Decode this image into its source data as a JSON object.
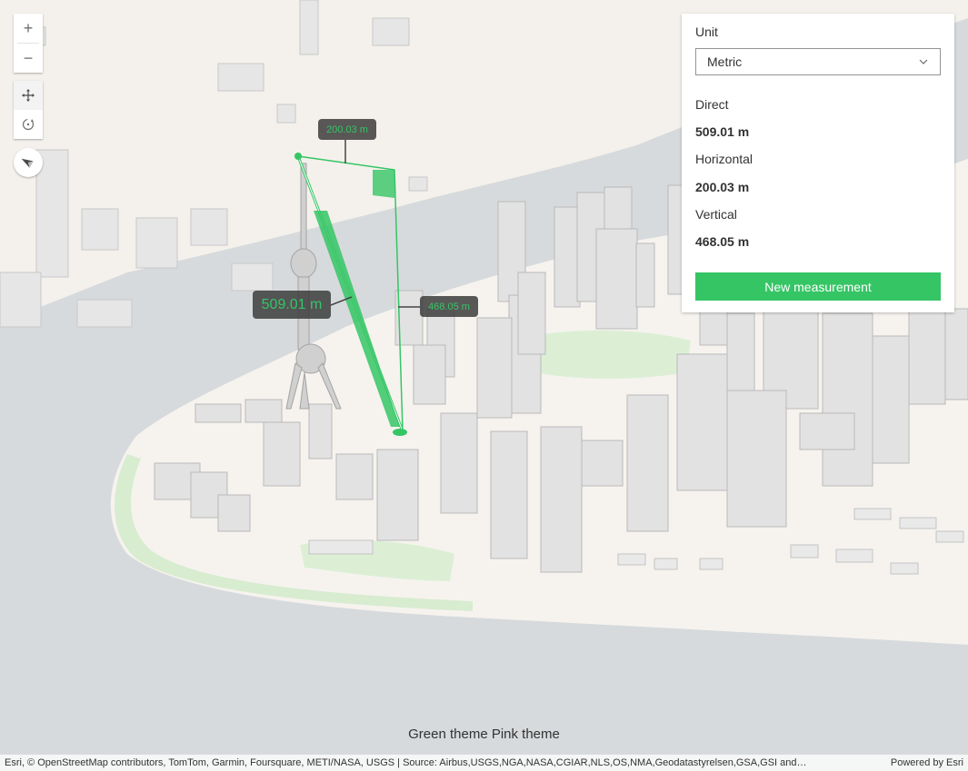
{
  "map_controls": {
    "zoom_in": "+",
    "zoom_out": "−"
  },
  "panel": {
    "unit_label": "Unit",
    "unit_value": "Metric",
    "direct_label": "Direct",
    "direct_value": "509.01 m",
    "horizontal_label": "Horizontal",
    "horizontal_value": "200.03 m",
    "vertical_label": "Vertical",
    "vertical_value": "468.05 m",
    "new_button": "New measurement"
  },
  "map_labels": {
    "direct": "509.01 m",
    "horizontal": "200.03 m",
    "vertical": "468.05 m"
  },
  "themes": {
    "green": "Green theme",
    "pink": "Pink theme"
  },
  "attribution": {
    "text": "Esri, © OpenStreetMap contributors, TomTom, Garmin, Foursquare, METI/NASA, USGS | Source: Airbus,USGS,NGA,NASA,CGIAR,NLS,OS,NMA,Geodatastyrelsen,GSA,GSI and…",
    "powered": "Powered by Esri"
  },
  "colors": {
    "accent": "#35c565",
    "water": "#d7dadc",
    "land": "#f6f3ef",
    "park": "#d8ecd0"
  }
}
